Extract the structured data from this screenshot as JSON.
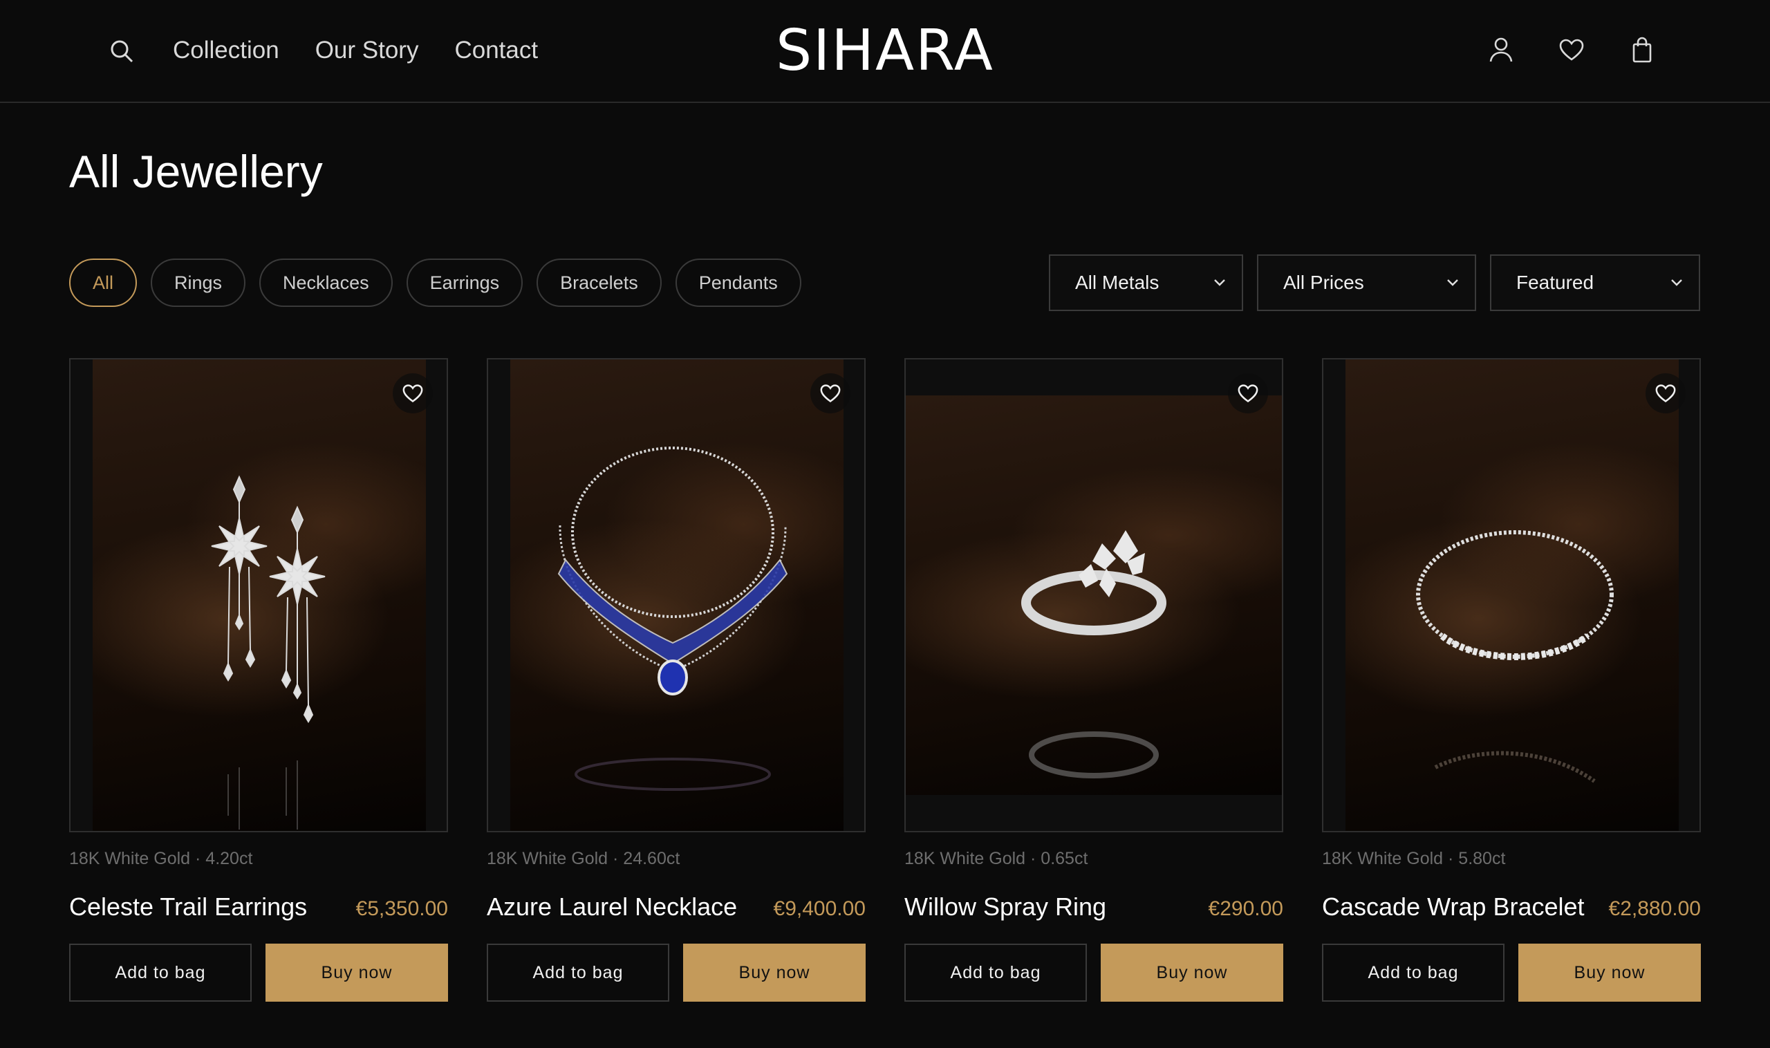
{
  "brand": {
    "logo": "SIHARA"
  },
  "nav": [
    {
      "label": "Collection"
    },
    {
      "label": "Our Story"
    },
    {
      "label": "Contact"
    }
  ],
  "header_icons": [
    "search-icon",
    "account-icon",
    "wishlist-icon",
    "bag-icon"
  ],
  "page": {
    "title": "All Jewellery"
  },
  "filters": {
    "chips": [
      {
        "label": "All",
        "active": true
      },
      {
        "label": "Rings"
      },
      {
        "label": "Necklaces"
      },
      {
        "label": "Earrings"
      },
      {
        "label": "Bracelets"
      },
      {
        "label": "Pendants"
      }
    ],
    "metal": "All Metals",
    "price": "All Prices",
    "sort": "Featured"
  },
  "products": [
    {
      "meta": "18K White Gold · 4.20ct",
      "name": "Celeste Trail Earrings",
      "price": "€5,350.00",
      "add_label": "Add to bag",
      "buy_label": "Buy now"
    },
    {
      "meta": "18K White Gold · 24.60ct",
      "name": "Azure Laurel Necklace",
      "price": "€9,400.00",
      "add_label": "Add to bag",
      "buy_label": "Buy now"
    },
    {
      "meta": "18K White Gold · 0.65ct",
      "name": "Willow Spray Ring",
      "price": "€290.00",
      "add_label": "Add to bag",
      "buy_label": "Buy now"
    },
    {
      "meta": "18K White Gold · 5.80ct",
      "name": "Cascade Wrap Bracelet",
      "price": "€2,880.00",
      "add_label": "Add to bag",
      "buy_label": "Buy now"
    }
  ],
  "colors": {
    "accent": "#c49a5a",
    "background": "#0b0b0b",
    "border": "#3a3a3a"
  }
}
